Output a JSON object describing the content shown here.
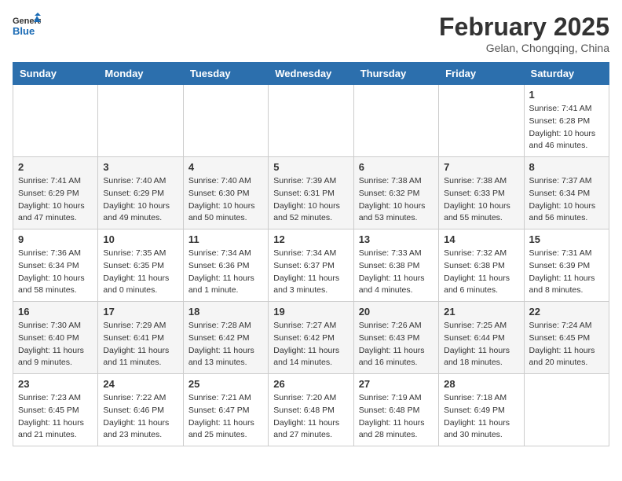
{
  "logo": {
    "line1": "General",
    "line2": "Blue"
  },
  "title": "February 2025",
  "location": "Gelan, Chongqing, China",
  "weekdays": [
    "Sunday",
    "Monday",
    "Tuesday",
    "Wednesday",
    "Thursday",
    "Friday",
    "Saturday"
  ],
  "weeks": [
    [
      {
        "day": "",
        "info": ""
      },
      {
        "day": "",
        "info": ""
      },
      {
        "day": "",
        "info": ""
      },
      {
        "day": "",
        "info": ""
      },
      {
        "day": "",
        "info": ""
      },
      {
        "day": "",
        "info": ""
      },
      {
        "day": "1",
        "info": "Sunrise: 7:41 AM\nSunset: 6:28 PM\nDaylight: 10 hours\nand 46 minutes."
      }
    ],
    [
      {
        "day": "2",
        "info": "Sunrise: 7:41 AM\nSunset: 6:29 PM\nDaylight: 10 hours\nand 47 minutes."
      },
      {
        "day": "3",
        "info": "Sunrise: 7:40 AM\nSunset: 6:29 PM\nDaylight: 10 hours\nand 49 minutes."
      },
      {
        "day": "4",
        "info": "Sunrise: 7:40 AM\nSunset: 6:30 PM\nDaylight: 10 hours\nand 50 minutes."
      },
      {
        "day": "5",
        "info": "Sunrise: 7:39 AM\nSunset: 6:31 PM\nDaylight: 10 hours\nand 52 minutes."
      },
      {
        "day": "6",
        "info": "Sunrise: 7:38 AM\nSunset: 6:32 PM\nDaylight: 10 hours\nand 53 minutes."
      },
      {
        "day": "7",
        "info": "Sunrise: 7:38 AM\nSunset: 6:33 PM\nDaylight: 10 hours\nand 55 minutes."
      },
      {
        "day": "8",
        "info": "Sunrise: 7:37 AM\nSunset: 6:34 PM\nDaylight: 10 hours\nand 56 minutes."
      }
    ],
    [
      {
        "day": "9",
        "info": "Sunrise: 7:36 AM\nSunset: 6:34 PM\nDaylight: 10 hours\nand 58 minutes."
      },
      {
        "day": "10",
        "info": "Sunrise: 7:35 AM\nSunset: 6:35 PM\nDaylight: 11 hours\nand 0 minutes."
      },
      {
        "day": "11",
        "info": "Sunrise: 7:34 AM\nSunset: 6:36 PM\nDaylight: 11 hours\nand 1 minute."
      },
      {
        "day": "12",
        "info": "Sunrise: 7:34 AM\nSunset: 6:37 PM\nDaylight: 11 hours\nand 3 minutes."
      },
      {
        "day": "13",
        "info": "Sunrise: 7:33 AM\nSunset: 6:38 PM\nDaylight: 11 hours\nand 4 minutes."
      },
      {
        "day": "14",
        "info": "Sunrise: 7:32 AM\nSunset: 6:38 PM\nDaylight: 11 hours\nand 6 minutes."
      },
      {
        "day": "15",
        "info": "Sunrise: 7:31 AM\nSunset: 6:39 PM\nDaylight: 11 hours\nand 8 minutes."
      }
    ],
    [
      {
        "day": "16",
        "info": "Sunrise: 7:30 AM\nSunset: 6:40 PM\nDaylight: 11 hours\nand 9 minutes."
      },
      {
        "day": "17",
        "info": "Sunrise: 7:29 AM\nSunset: 6:41 PM\nDaylight: 11 hours\nand 11 minutes."
      },
      {
        "day": "18",
        "info": "Sunrise: 7:28 AM\nSunset: 6:42 PM\nDaylight: 11 hours\nand 13 minutes."
      },
      {
        "day": "19",
        "info": "Sunrise: 7:27 AM\nSunset: 6:42 PM\nDaylight: 11 hours\nand 14 minutes."
      },
      {
        "day": "20",
        "info": "Sunrise: 7:26 AM\nSunset: 6:43 PM\nDaylight: 11 hours\nand 16 minutes."
      },
      {
        "day": "21",
        "info": "Sunrise: 7:25 AM\nSunset: 6:44 PM\nDaylight: 11 hours\nand 18 minutes."
      },
      {
        "day": "22",
        "info": "Sunrise: 7:24 AM\nSunset: 6:45 PM\nDaylight: 11 hours\nand 20 minutes."
      }
    ],
    [
      {
        "day": "23",
        "info": "Sunrise: 7:23 AM\nSunset: 6:45 PM\nDaylight: 11 hours\nand 21 minutes."
      },
      {
        "day": "24",
        "info": "Sunrise: 7:22 AM\nSunset: 6:46 PM\nDaylight: 11 hours\nand 23 minutes."
      },
      {
        "day": "25",
        "info": "Sunrise: 7:21 AM\nSunset: 6:47 PM\nDaylight: 11 hours\nand 25 minutes."
      },
      {
        "day": "26",
        "info": "Sunrise: 7:20 AM\nSunset: 6:48 PM\nDaylight: 11 hours\nand 27 minutes."
      },
      {
        "day": "27",
        "info": "Sunrise: 7:19 AM\nSunset: 6:48 PM\nDaylight: 11 hours\nand 28 minutes."
      },
      {
        "day": "28",
        "info": "Sunrise: 7:18 AM\nSunset: 6:49 PM\nDaylight: 11 hours\nand 30 minutes."
      },
      {
        "day": "",
        "info": ""
      }
    ]
  ]
}
